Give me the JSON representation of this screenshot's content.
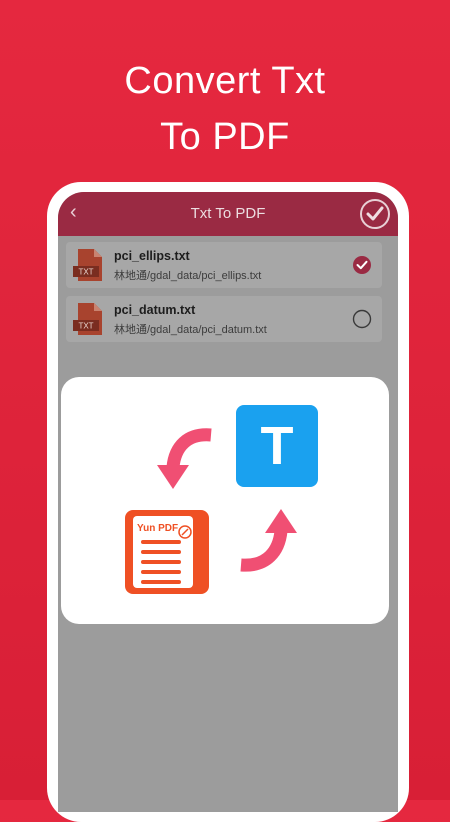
{
  "headline": {
    "line1": "Convert Txt",
    "line2": "To PDF"
  },
  "app_bar": {
    "title": "Txt To PDF"
  },
  "files": [
    {
      "name": "pci_ellips.txt",
      "path": "林地通/gdal_data/pci_ellips.txt",
      "icon_label": "TXT",
      "selected": true
    },
    {
      "name": "pci_datum.txt",
      "path": "林地通/gdal_data/pci_datum.txt",
      "icon_label": "TXT",
      "selected": false
    }
  ],
  "conversion_card": {
    "source_icon_letter": "T",
    "target_icon_label": "Yun PDF"
  },
  "colors": {
    "background": "#e0243b",
    "app_bar": "#9a2a43",
    "txt_tile": "#1aa1ef",
    "pdf_tile": "#ef5024",
    "arrows": "#f04f73",
    "file_icon": "#a8432e"
  }
}
